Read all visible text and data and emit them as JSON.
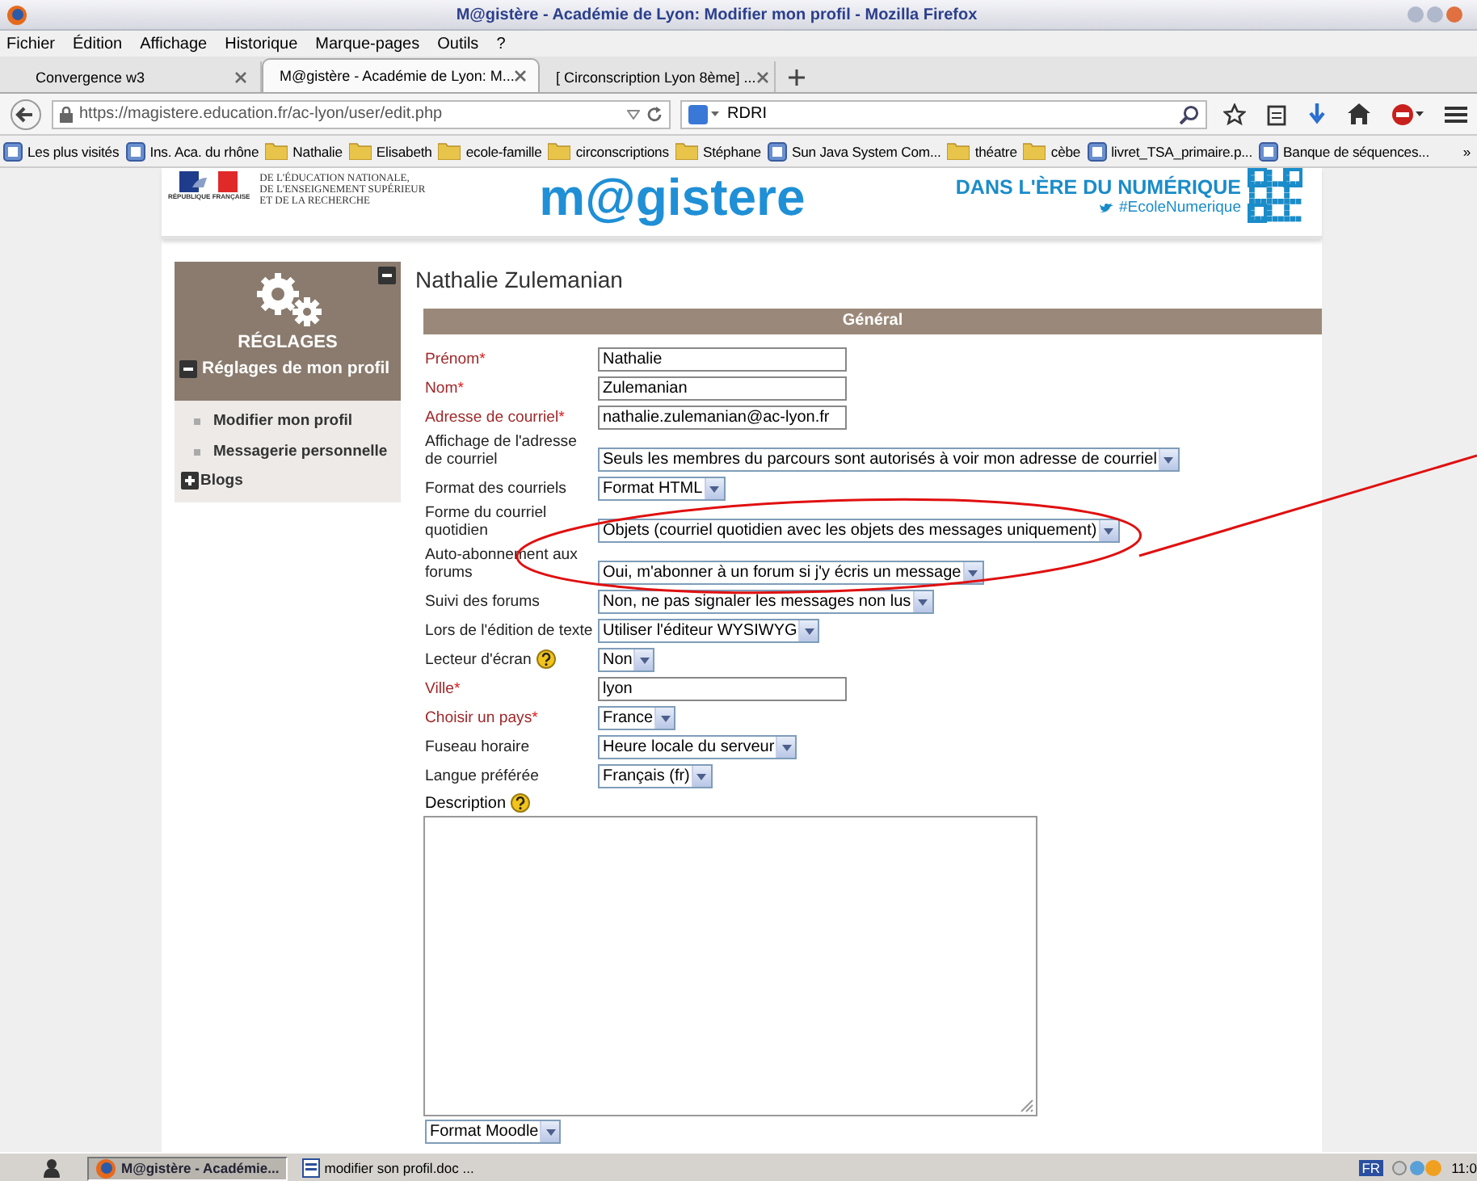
{
  "window": {
    "title": "M@gistère - Académie de Lyon: Modifier mon profil - Mozilla Firefox"
  },
  "menu": [
    "Fichier",
    "Édition",
    "Affichage",
    "Historique",
    "Marque-pages",
    "Outils",
    "?"
  ],
  "tabs": [
    {
      "label": "Convergence w3",
      "selected": false
    },
    {
      "label": "M@gistère - Académie de Lyon: M...",
      "selected": true
    },
    {
      "label": "[ Circonscription Lyon 8ème] ...",
      "selected": false
    }
  ],
  "address_bar": {
    "url": "https://magistere.education.fr/ac-lyon/user/edit.php"
  },
  "search_field": {
    "value": "RDRI"
  },
  "bookmarks": {
    "items": [
      {
        "label": "Les plus visités",
        "kind": "site"
      },
      {
        "label": "Ins. Aca. du rhône",
        "kind": "site"
      },
      {
        "label": "Nathalie",
        "kind": "folder"
      },
      {
        "label": "Elisabeth",
        "kind": "folder"
      },
      {
        "label": "ecole-famille",
        "kind": "folder"
      },
      {
        "label": "circonscriptions",
        "kind": "folder"
      },
      {
        "label": "Stéphane",
        "kind": "folder"
      },
      {
        "label": "Sun Java System Com...",
        "kind": "site"
      },
      {
        "label": "théatre",
        "kind": "folder"
      },
      {
        "label": "cèbe",
        "kind": "folder"
      },
      {
        "label": "livret_TSA_primaire.p...",
        "kind": "site"
      },
      {
        "label": "Banque de séquences...",
        "kind": "site"
      }
    ],
    "overflow": "»"
  },
  "banner": {
    "ministry": [
      "DE L'ÉDUCATION NATIONALE,",
      "DE L'ENSEIGNEMENT SUPÉRIEUR",
      "ET DE LA RECHERCHE"
    ],
    "republic": "RÉPUBLIQUE FRANÇAISE",
    "brand": "m@gistere",
    "slogan": "DANS L'ÈRE DU NUMÉRIQUE",
    "hashtag": "#EcoleNumerique"
  },
  "sidebar": {
    "title": "RÉGLAGES",
    "section": {
      "label": "Réglages de mon profil",
      "expanded": true,
      "items": [
        "Modifier mon profil",
        "Messagerie personnelle"
      ]
    },
    "blogs": {
      "label": "Blogs",
      "expanded": false
    }
  },
  "profile_name": "Nathalie Zulemanian",
  "form": {
    "section": "Général",
    "required_mark": "*",
    "fields": [
      {
        "label": "Prénom",
        "required": true,
        "help": false,
        "kind": "text",
        "value": "Nathalie"
      },
      {
        "label": "Nom",
        "required": true,
        "help": false,
        "kind": "text",
        "value": "Zulemanian"
      },
      {
        "label": "Adresse de courriel",
        "required": true,
        "help": false,
        "kind": "text",
        "value": "nathalie.zulemanian@ac-lyon.fr"
      },
      {
        "label": "Affichage de l'adresse de courriel",
        "required": false,
        "help": false,
        "kind": "select",
        "value": "Seuls les membres du parcours sont autorisés à voir mon adresse de courriel"
      },
      {
        "label": "Format des courriels",
        "required": false,
        "help": false,
        "kind": "select",
        "value": "Format HTML"
      },
      {
        "label": "Forme du courriel quotidien",
        "required": false,
        "help": false,
        "kind": "select",
        "value": "Objets (courriel quotidien avec les objets des messages uniquement)"
      },
      {
        "label": "Auto-abonnement aux forums",
        "required": false,
        "help": false,
        "kind": "select",
        "value": "Oui, m'abonner à un forum si j'y écris un message"
      },
      {
        "label": "Suivi des forums",
        "required": false,
        "help": false,
        "kind": "select",
        "value": "Non, ne pas signaler les messages non lus"
      },
      {
        "label": "Lors de l'édition de texte",
        "required": false,
        "help": false,
        "kind": "select",
        "value": "Utiliser l'éditeur WYSIWYG"
      },
      {
        "label": "Lecteur d'écran",
        "required": false,
        "help": true,
        "kind": "select",
        "value": "Non"
      },
      {
        "label": "Ville",
        "required": true,
        "help": false,
        "kind": "text",
        "value": "lyon"
      },
      {
        "label": "Choisir un pays",
        "required": true,
        "help": false,
        "kind": "select",
        "value": "France"
      },
      {
        "label": "Fuseau horaire",
        "required": false,
        "help": false,
        "kind": "select",
        "value": "Heure locale du serveur"
      },
      {
        "label": "Langue préférée",
        "required": false,
        "help": false,
        "kind": "select",
        "value": "Français (fr)"
      }
    ],
    "description": {
      "label": "Description",
      "help": true,
      "format": "Format Moodle"
    }
  },
  "taskbar": {
    "buttons": [
      {
        "label": "M@gistère - Académie...",
        "selected": true
      },
      {
        "label": "modifier son profil.doc ...",
        "selected": false
      }
    ],
    "language": "FR",
    "clock": "11:0"
  }
}
